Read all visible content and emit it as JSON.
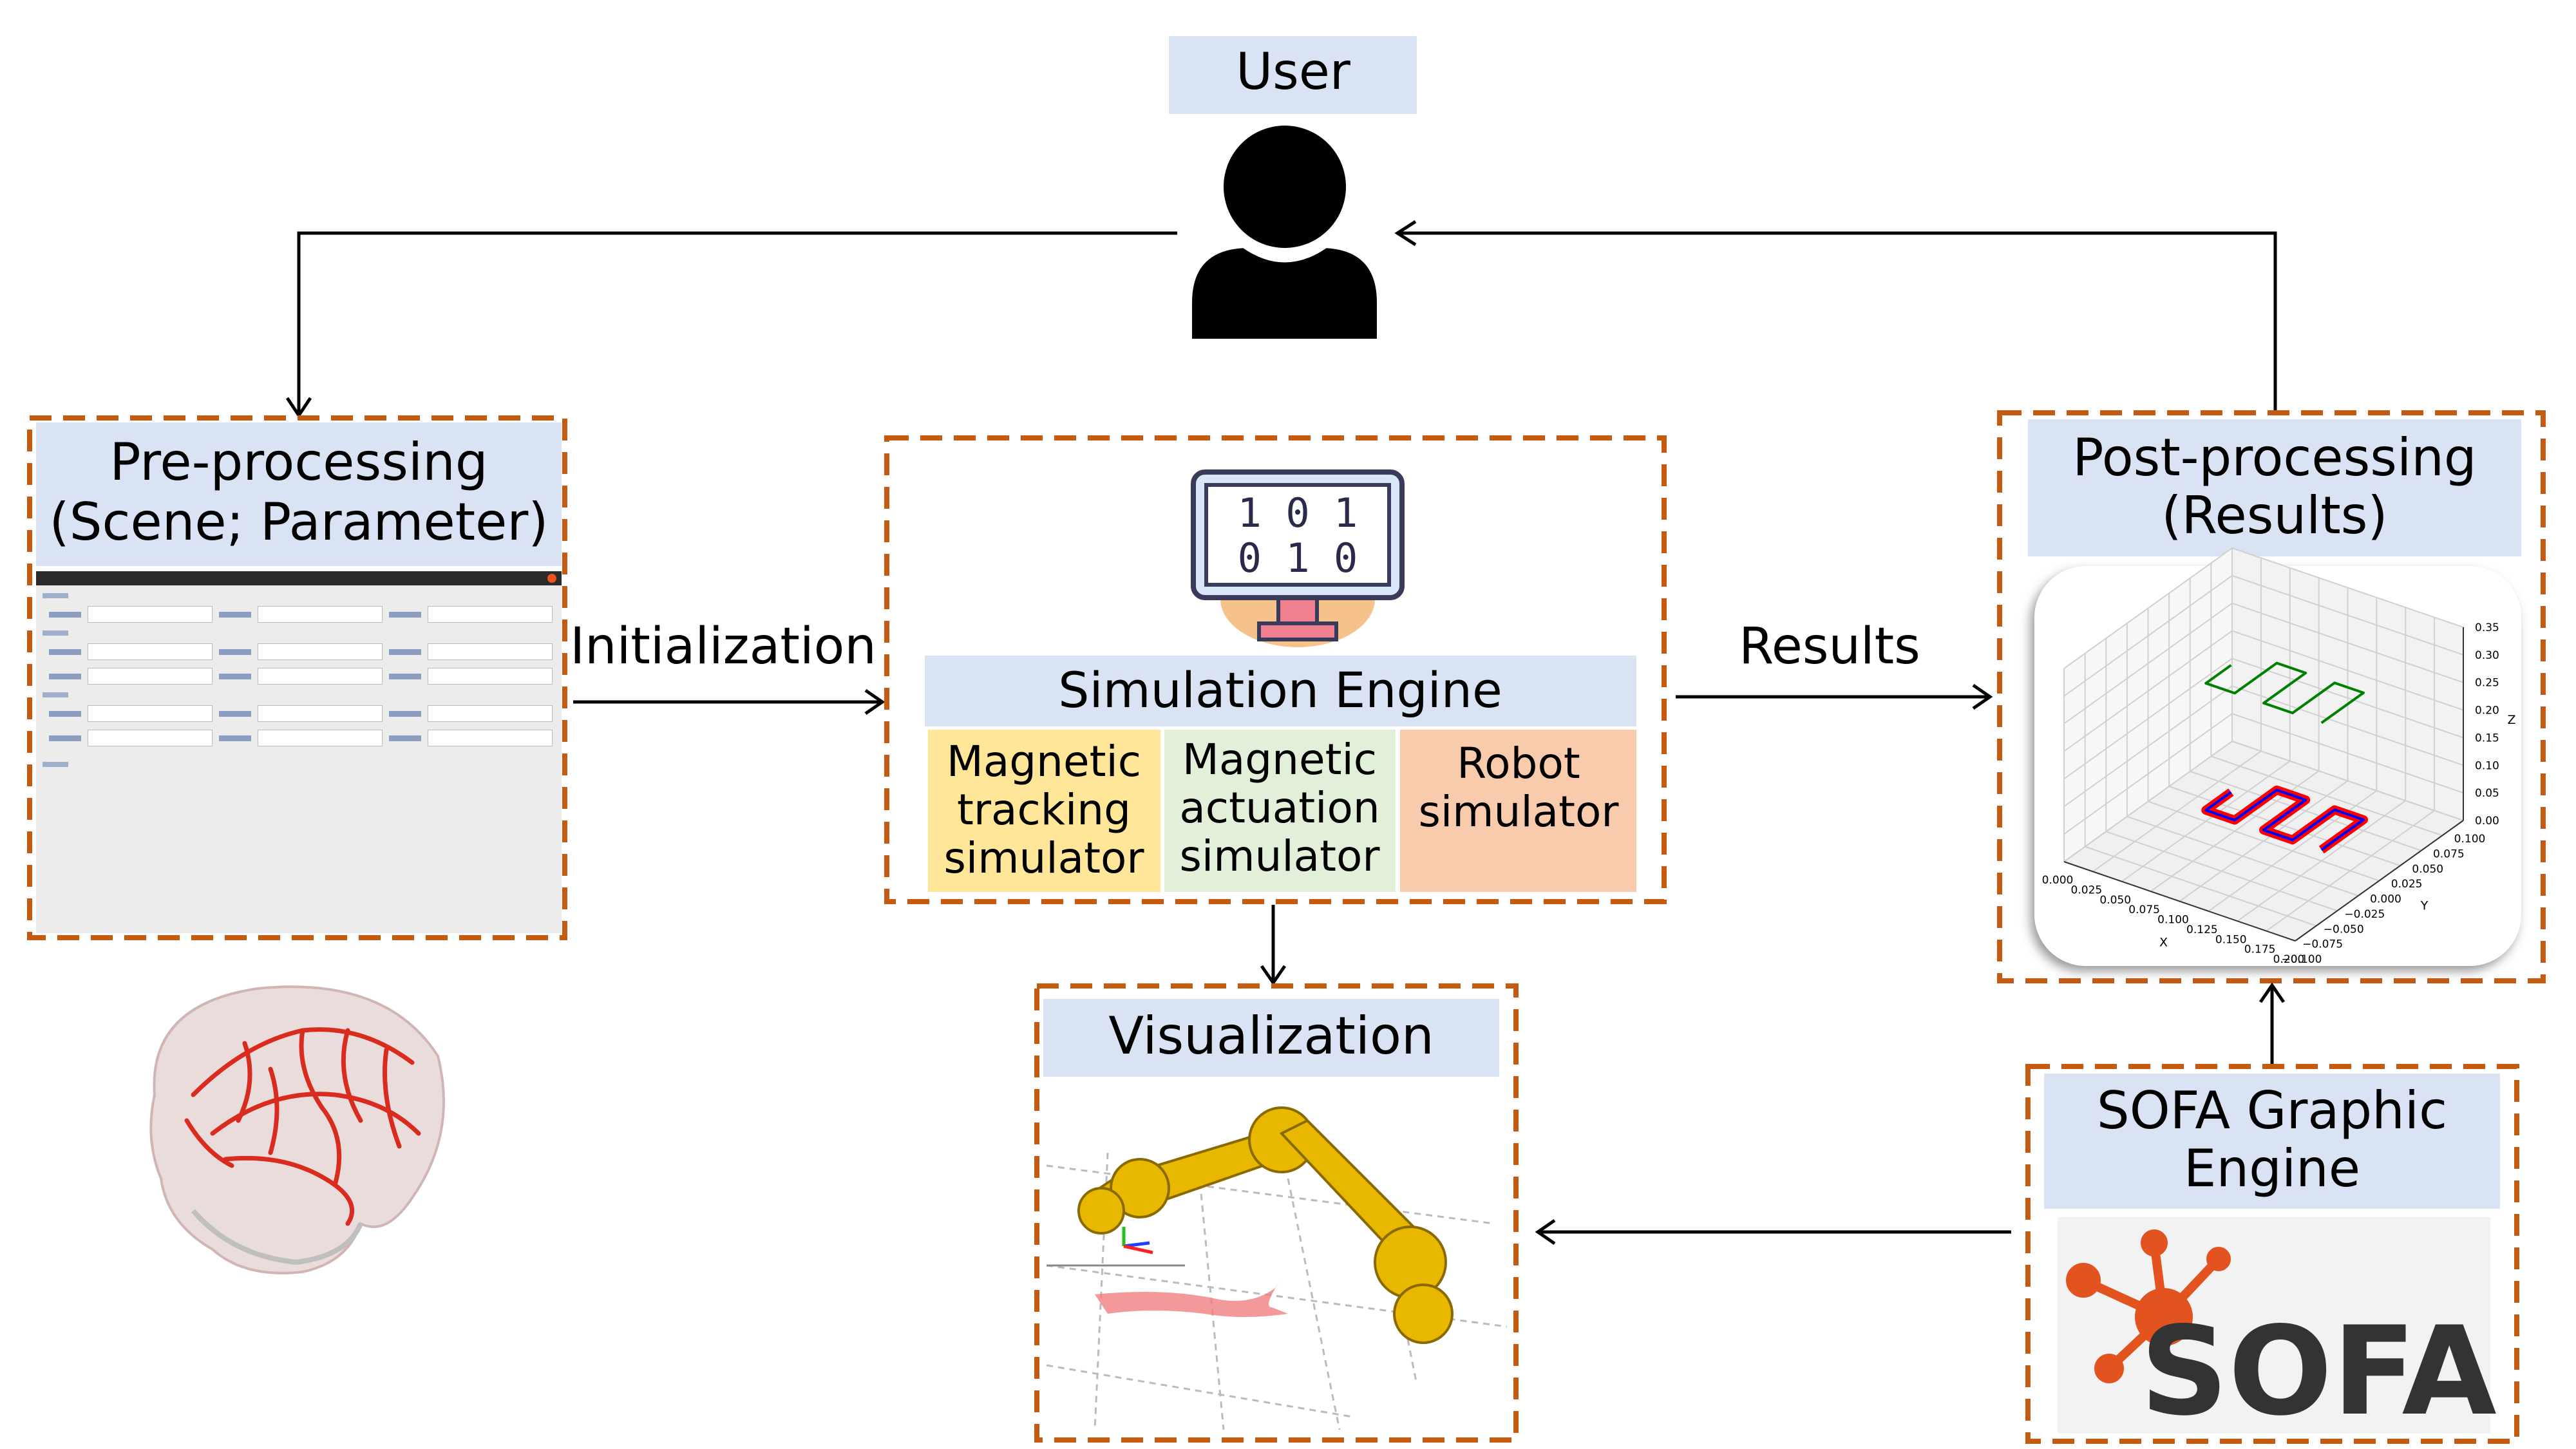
{
  "user": {
    "label": "User",
    "icon": "user-icon"
  },
  "pre_processing": {
    "title_line1": "Pre-processing",
    "title_line2": "(Scene; Parameter)"
  },
  "initialization_label": "Initialization",
  "simulation_engine": {
    "title": "Simulation Engine",
    "icon": "binary-monitor-icon",
    "binary_line1": "1 0 1",
    "binary_line2": "0 1 0",
    "modules": [
      {
        "line1": "Magnetic",
        "line2": "tracking",
        "line3": "simulator",
        "color": "#ffe699"
      },
      {
        "line1": "Magnetic",
        "line2": "actuation",
        "line3": "simulator",
        "color": "#e2f0d9"
      },
      {
        "line1": "Robot",
        "line2": "simulator",
        "color": "#f8cbad"
      }
    ]
  },
  "results_label": "Results",
  "visualization": {
    "title": "Visualization"
  },
  "post_processing": {
    "title_line1": "Post-processing",
    "title_line2": "(Results)"
  },
  "sofa": {
    "title_line1": "SOFA Graphic",
    "title_line2": "Engine",
    "logo_text": "SOFA",
    "logo_color": "#e2531f"
  },
  "colors": {
    "dashed_border": "#c55a11",
    "title_fill": "#dae3f3"
  },
  "chart_data": {
    "type": "line3d",
    "xlabel": "X",
    "ylabel": "Y",
    "zlabel": "Z",
    "xlim": [
      0.0,
      0.2
    ],
    "ylim": [
      -0.1,
      0.1
    ],
    "zlim": [
      0.0,
      0.35
    ],
    "x_ticks": [
      "0.000",
      "0.025",
      "0.050",
      "0.075",
      "0.100",
      "0.125",
      "0.150",
      "0.175",
      "0.200"
    ],
    "y_ticks": [
      "−0.100",
      "−0.075",
      "−0.050",
      "−0.025",
      "0.000",
      "0.025",
      "0.050",
      "0.075",
      "0.100"
    ],
    "z_ticks": [
      "0.00",
      "0.05",
      "0.10",
      "0.15",
      "0.20",
      "0.25",
      "0.30",
      "0.35"
    ],
    "grid": true,
    "series": [
      {
        "color": "#ff0000",
        "z": 0.02,
        "x": [
          0.05,
          0.05,
          0.075,
          0.075,
          0.1,
          0.1,
          0.125,
          0.125,
          0.15,
          0.15
        ],
        "y": [
          0.03,
          0.0,
          0.0,
          0.05,
          0.05,
          0.0,
          0.0,
          0.05,
          0.05,
          0.0
        ]
      },
      {
        "color": "#0000ff",
        "z": 0.02,
        "x": [
          0.05,
          0.05,
          0.075,
          0.075,
          0.1,
          0.1,
          0.125,
          0.125,
          0.15,
          0.15
        ],
        "y": [
          0.03,
          0.0,
          0.0,
          0.05,
          0.05,
          0.0,
          0.0,
          0.05,
          0.05,
          0.0
        ]
      },
      {
        "color": "#008000",
        "z": 0.25,
        "x": [
          0.05,
          0.05,
          0.075,
          0.075,
          0.1,
          0.1,
          0.125,
          0.125,
          0.15,
          0.15
        ],
        "y": [
          0.03,
          0.0,
          0.0,
          0.05,
          0.05,
          0.0,
          0.0,
          0.05,
          0.05,
          0.0
        ]
      }
    ]
  }
}
